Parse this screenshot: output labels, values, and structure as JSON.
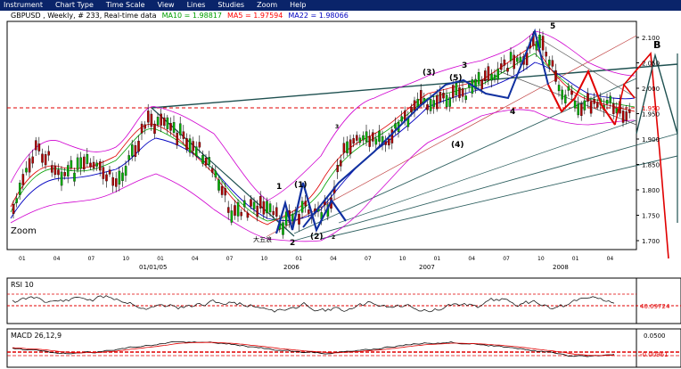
{
  "menu": {
    "items": [
      "Instrument",
      "Chart Type",
      "Time Scale",
      "View",
      "Lines",
      "Studies",
      "Zoom",
      "Help"
    ]
  },
  "header": {
    "symbol": "GBPUSD , Weekly, # 233, Real-time data",
    "ma10": "MA10 = 1.98817",
    "ma5": "MA5 = 1.97594",
    "ma22": "MA22 = 1.98066",
    "colors": {
      "ma10": "#00a000",
      "ma5": "#ff0000",
      "ma22": "#0000c0"
    }
  },
  "main_chart": {
    "price_axis": [
      "2.100",
      "2.050",
      "2.000",
      "1.950",
      "1.900",
      "1.850",
      "1.800",
      "1.750",
      "1.700"
    ],
    "current_price_label": "1.950",
    "time_ticks": [
      "01",
      "04",
      "07",
      "10",
      "01",
      "04",
      "07",
      "10",
      "01",
      "04",
      "07",
      "10",
      "01",
      "04",
      "07",
      "10",
      "01",
      "04"
    ],
    "year_labels": [
      "01/01/05",
      "2006",
      "2007",
      "2008"
    ],
    "zoom_label": "Zoom",
    "wave_labels": [
      "1",
      "2",
      "(1)",
      "(2)",
      "2",
      "3",
      "(3)",
      "(5)",
      "3",
      "5",
      "4",
      "(4)",
      "B"
    ],
    "chinese_label": "大五浪"
  },
  "rsi": {
    "title": "RSI 10",
    "value": "40.09724"
  },
  "macd": {
    "title": "MACD 26,12,9",
    "value_top": "0.0500",
    "value": "-0.00961"
  }
}
